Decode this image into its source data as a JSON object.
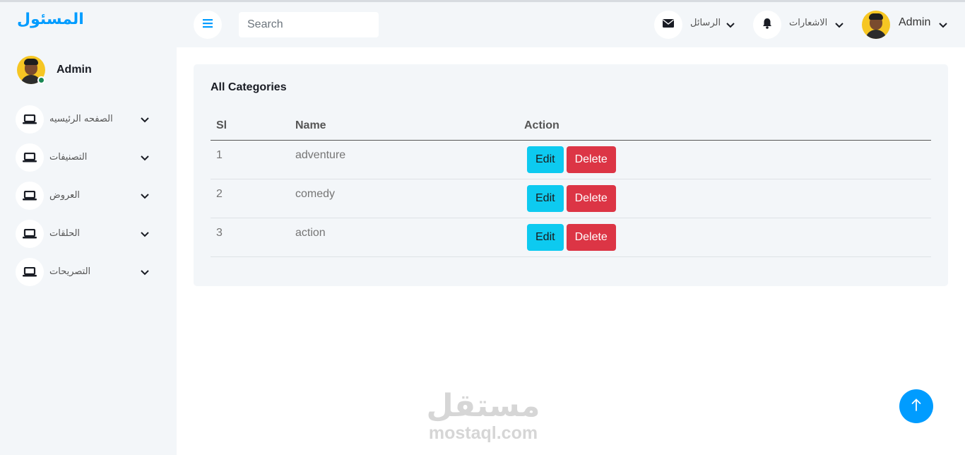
{
  "brand": "المسئول",
  "profile": {
    "name": "Admin"
  },
  "sidebar": {
    "items": [
      {
        "label": "الصفحه الرئيسيه"
      },
      {
        "label": "التصنيفات"
      },
      {
        "label": "العروض"
      },
      {
        "label": "الحلقات"
      },
      {
        "label": "التصريحات"
      }
    ]
  },
  "header": {
    "search_placeholder": "Search",
    "messages_label": "الرسائل",
    "notifications_label": "الاشعارات",
    "user_label": "Admin"
  },
  "card": {
    "title": "All Categories",
    "columns": [
      "Sl",
      "Name",
      "Action"
    ],
    "rows": [
      {
        "sl": "1",
        "name": "adventure",
        "edit": "Edit",
        "delete": "Delete"
      },
      {
        "sl": "2",
        "name": "comedy",
        "edit": "Edit",
        "delete": "Delete"
      },
      {
        "sl": "3",
        "name": "action",
        "edit": "Edit",
        "delete": "Delete"
      }
    ]
  },
  "watermark": {
    "arabic": "مستقل",
    "latin": "mostaql.com"
  },
  "colors": {
    "primary": "#009cff",
    "panel": "#f3f6f9",
    "edit": "#0dcaf0",
    "delete": "#dc3545",
    "online": "#198754"
  }
}
